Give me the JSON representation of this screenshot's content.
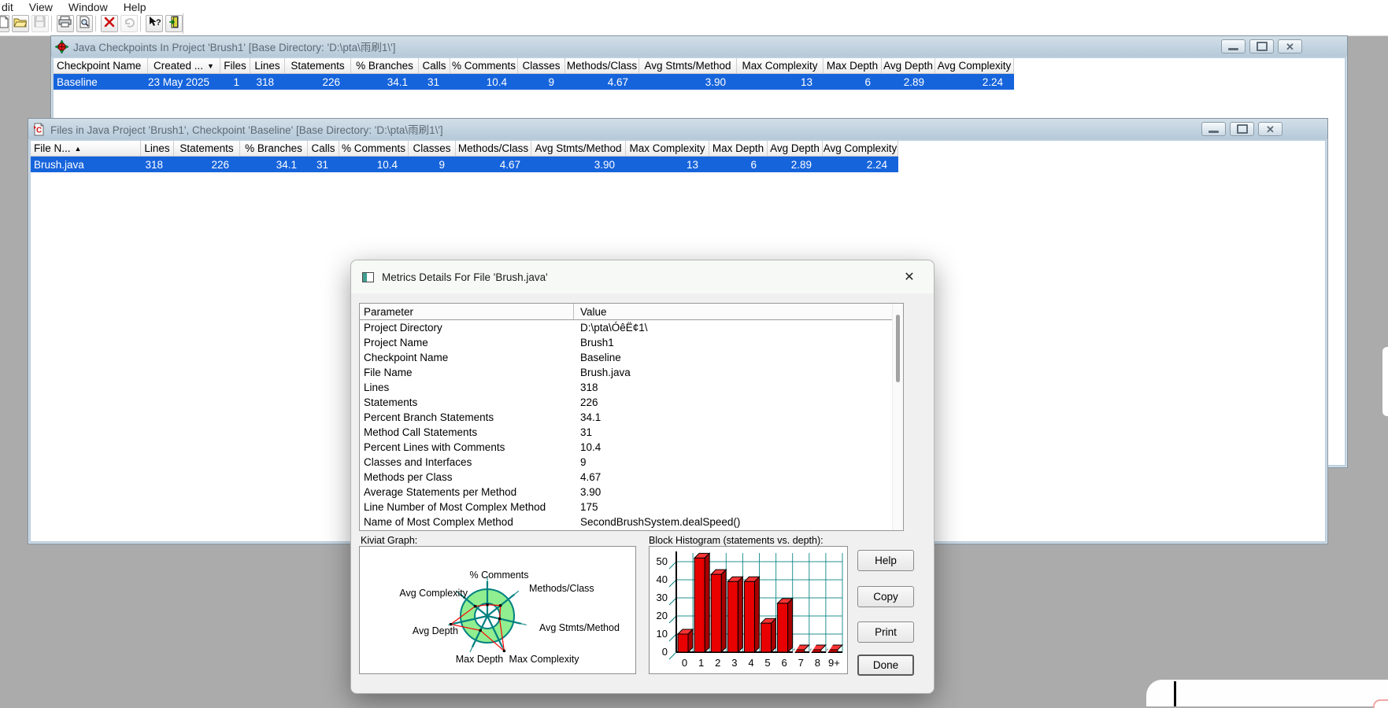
{
  "menu": {
    "items": [
      "dit",
      "View",
      "Window",
      "Help"
    ]
  },
  "toolbar": {
    "icons": [
      "new-document",
      "open-folder",
      "save",
      "print",
      "print-preview",
      "delete",
      "undo",
      "context-help",
      "exit"
    ]
  },
  "colors": {
    "selection": "#1664dc",
    "titlebar_text": "#5d6b77",
    "grid": "#008080",
    "ring_fill": "#90ee90",
    "kiviat_axis": "#008080",
    "kiviat_polygon": "#ff0000",
    "bar_front": "#e90000",
    "bar_top": "#ff3434",
    "bar_side": "#a80000"
  },
  "window1": {
    "title": "Java Checkpoints In Project 'Brush1'  [Base Directory: 'D:\\pta\\雨刷1\\']",
    "columns": [
      {
        "label": "Checkpoint Name"
      },
      {
        "label": "Created ...",
        "sort": "▼"
      },
      {
        "label": "Files"
      },
      {
        "label": "Lines"
      },
      {
        "label": "Statements"
      },
      {
        "label": "% Branches"
      },
      {
        "label": "Calls"
      },
      {
        "label": "% Comments"
      },
      {
        "label": "Classes"
      },
      {
        "label": "Methods/Class"
      },
      {
        "label": "Avg Stmts/Method"
      },
      {
        "label": "Max Complexity"
      },
      {
        "label": "Max Depth"
      },
      {
        "label": "Avg Depth"
      },
      {
        "label": "Avg Complexity"
      }
    ],
    "row": [
      "Baseline",
      "23 May 2025",
      "1",
      "318",
      "226",
      "34.1",
      "31",
      "10.4",
      "9",
      "4.67",
      "3.90",
      "13",
      "6",
      "2.89",
      "2.24"
    ]
  },
  "window2": {
    "title": "Files in Java Project 'Brush1', Checkpoint 'Baseline'  [Base Directory: 'D:\\pta\\雨刷1\\']",
    "columns": [
      {
        "label": "File N...",
        "sort": "▲"
      },
      {
        "label": "Lines"
      },
      {
        "label": "Statements"
      },
      {
        "label": "% Branches"
      },
      {
        "label": "Calls"
      },
      {
        "label": "% Comments"
      },
      {
        "label": "Classes"
      },
      {
        "label": "Methods/Class"
      },
      {
        "label": "Avg Stmts/Method"
      },
      {
        "label": "Max Complexity"
      },
      {
        "label": "Max Depth"
      },
      {
        "label": "Avg Depth"
      },
      {
        "label": "Avg Complexity"
      }
    ],
    "row": [
      "Brush.java",
      "318",
      "226",
      "34.1",
      "31",
      "10.4",
      "9",
      "4.67",
      "3.90",
      "13",
      "6",
      "2.89",
      "2.24"
    ]
  },
  "dialog": {
    "title": "Metrics Details For File 'Brush.java'",
    "params_header": {
      "parameter": "Parameter",
      "value": "Value"
    },
    "params": [
      [
        "Project Directory",
        "D:\\pta\\ÓêË¢1\\"
      ],
      [
        "Project Name",
        "Brush1"
      ],
      [
        "Checkpoint Name",
        "Baseline"
      ],
      [
        "File Name",
        "Brush.java"
      ],
      [
        "Lines",
        "318"
      ],
      [
        "Statements",
        "226"
      ],
      [
        "Percent Branch Statements",
        "34.1"
      ],
      [
        "Method Call Statements",
        "31"
      ],
      [
        "Percent Lines with Comments",
        "10.4"
      ],
      [
        "Classes and Interfaces",
        "9"
      ],
      [
        "Methods per Class",
        "4.67"
      ],
      [
        "Average Statements per Method",
        "3.90"
      ],
      [
        "Line Number of Most Complex Method",
        "175"
      ],
      [
        "Name of Most Complex Method",
        "SecondBrushSystem.dealSpeed()"
      ]
    ],
    "kiviat": {
      "label": "Kiviat Graph:",
      "type": "radar",
      "axes": [
        "% Comments",
        "Methods/Class",
        "Avg Stmts/Method",
        "Max Complexity",
        "Max Depth",
        "Avg Depth",
        "Avg Complexity"
      ],
      "values_r": [
        0.42,
        0.63,
        0.47,
        1.45,
        0.6,
        1.4,
        0.58
      ],
      "ring": {
        "inner": 0.47,
        "outer": 1.0
      }
    },
    "histogram": {
      "label": "Block Histogram (statements vs. depth):",
      "type": "bar",
      "categories": [
        "0",
        "1",
        "2",
        "3",
        "4",
        "5",
        "6",
        "7",
        "8",
        "9+"
      ],
      "values": [
        10,
        52,
        43,
        39,
        39,
        16,
        27,
        0,
        0,
        0
      ],
      "y_ticks": [
        0,
        10,
        20,
        30,
        40,
        50
      ],
      "xlabel": "depth",
      "ylabel": "statements"
    },
    "buttons": [
      "Help",
      "Copy",
      "Print",
      "Done"
    ]
  }
}
